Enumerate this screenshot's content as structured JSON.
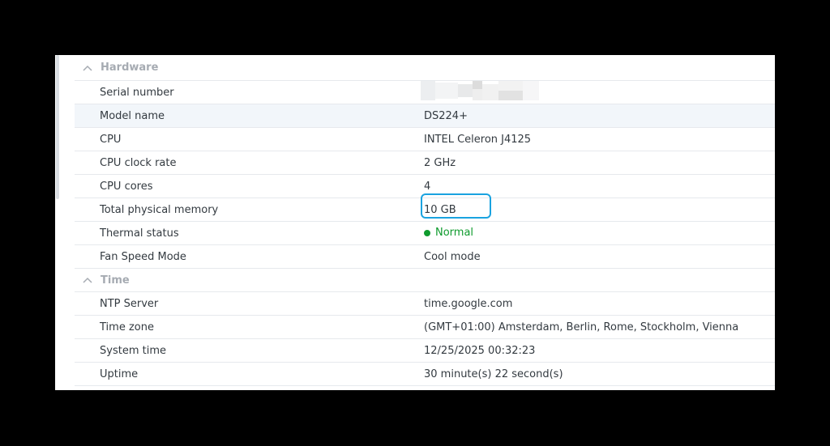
{
  "colors": {
    "accent_highlight_box": "#1aa3e0",
    "status_normal": "#0f9b2e",
    "section_title": "#a6abb2",
    "row_highlight": "#f2f6fa"
  },
  "sections": [
    {
      "title": "Hardware",
      "icon": "chevron-up-icon",
      "rows": [
        {
          "label": "Serial number",
          "value": ""
        },
        {
          "label": "Model name",
          "value": "DS224+"
        },
        {
          "label": "CPU",
          "value": "INTEL Celeron J4125"
        },
        {
          "label": "CPU clock rate",
          "value": "2 GHz"
        },
        {
          "label": "CPU cores",
          "value": "4"
        },
        {
          "label": "Total physical memory",
          "value": "10 GB"
        },
        {
          "label": "Thermal status",
          "value": "Normal"
        },
        {
          "label": "Fan Speed Mode",
          "value": "Cool mode"
        }
      ]
    },
    {
      "title": "Time",
      "icon": "chevron-up-icon",
      "rows": [
        {
          "label": "NTP Server",
          "value": "time.google.com"
        },
        {
          "label": "Time zone",
          "value": "(GMT+01:00) Amsterdam, Berlin, Rome, Stockholm, Vienna"
        },
        {
          "label": "System time",
          "value": "12/25/2025 00:32:23"
        },
        {
          "label": "Uptime",
          "value": "30 minute(s) 22 second(s)"
        }
      ]
    }
  ]
}
